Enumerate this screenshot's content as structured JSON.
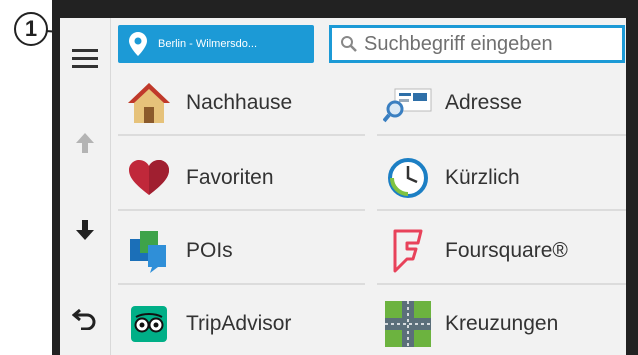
{
  "callout": {
    "number": "1"
  },
  "location_button": {
    "label": "Berlin - Wilmersdo..."
  },
  "search": {
    "placeholder": "Suchbegriff eingeben"
  },
  "sidebar": {
    "items": [
      "menu-icon",
      "arrow-up-icon",
      "arrow-down-icon",
      "back-icon"
    ]
  },
  "categories": [
    {
      "label": "Nachhause",
      "icon": "house-icon"
    },
    {
      "label": "Adresse",
      "icon": "address-icon"
    },
    {
      "label": "Favoriten",
      "icon": "heart-icon"
    },
    {
      "label": "Kürzlich",
      "icon": "clock-icon"
    },
    {
      "label": "POIs",
      "icon": "poi-flags-icon"
    },
    {
      "label": "Foursquare®",
      "icon": "foursquare-icon"
    },
    {
      "label": "TripAdvisor",
      "icon": "tripadvisor-icon"
    },
    {
      "label": "Kreuzungen",
      "icon": "intersection-icon"
    }
  ],
  "colors": {
    "accent": "#1c9ad6",
    "background": "#f2f2f2",
    "bezel": "#222222"
  }
}
